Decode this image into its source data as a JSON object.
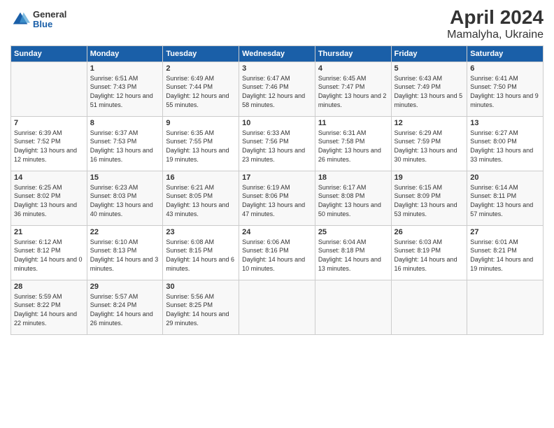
{
  "header": {
    "logo_general": "General",
    "logo_blue": "Blue",
    "title": "April 2024",
    "subtitle": "Mamalyha, Ukraine"
  },
  "columns": [
    "Sunday",
    "Monday",
    "Tuesday",
    "Wednesday",
    "Thursday",
    "Friday",
    "Saturday"
  ],
  "weeks": [
    [
      {
        "day": "",
        "sunrise": "",
        "sunset": "",
        "daylight": ""
      },
      {
        "day": "1",
        "sunrise": "Sunrise: 6:51 AM",
        "sunset": "Sunset: 7:43 PM",
        "daylight": "Daylight: 12 hours and 51 minutes."
      },
      {
        "day": "2",
        "sunrise": "Sunrise: 6:49 AM",
        "sunset": "Sunset: 7:44 PM",
        "daylight": "Daylight: 12 hours and 55 minutes."
      },
      {
        "day": "3",
        "sunrise": "Sunrise: 6:47 AM",
        "sunset": "Sunset: 7:46 PM",
        "daylight": "Daylight: 12 hours and 58 minutes."
      },
      {
        "day": "4",
        "sunrise": "Sunrise: 6:45 AM",
        "sunset": "Sunset: 7:47 PM",
        "daylight": "Daylight: 13 hours and 2 minutes."
      },
      {
        "day": "5",
        "sunrise": "Sunrise: 6:43 AM",
        "sunset": "Sunset: 7:49 PM",
        "daylight": "Daylight: 13 hours and 5 minutes."
      },
      {
        "day": "6",
        "sunrise": "Sunrise: 6:41 AM",
        "sunset": "Sunset: 7:50 PM",
        "daylight": "Daylight: 13 hours and 9 minutes."
      }
    ],
    [
      {
        "day": "7",
        "sunrise": "Sunrise: 6:39 AM",
        "sunset": "Sunset: 7:52 PM",
        "daylight": "Daylight: 13 hours and 12 minutes."
      },
      {
        "day": "8",
        "sunrise": "Sunrise: 6:37 AM",
        "sunset": "Sunset: 7:53 PM",
        "daylight": "Daylight: 13 hours and 16 minutes."
      },
      {
        "day": "9",
        "sunrise": "Sunrise: 6:35 AM",
        "sunset": "Sunset: 7:55 PM",
        "daylight": "Daylight: 13 hours and 19 minutes."
      },
      {
        "day": "10",
        "sunrise": "Sunrise: 6:33 AM",
        "sunset": "Sunset: 7:56 PM",
        "daylight": "Daylight: 13 hours and 23 minutes."
      },
      {
        "day": "11",
        "sunrise": "Sunrise: 6:31 AM",
        "sunset": "Sunset: 7:58 PM",
        "daylight": "Daylight: 13 hours and 26 minutes."
      },
      {
        "day": "12",
        "sunrise": "Sunrise: 6:29 AM",
        "sunset": "Sunset: 7:59 PM",
        "daylight": "Daylight: 13 hours and 30 minutes."
      },
      {
        "day": "13",
        "sunrise": "Sunrise: 6:27 AM",
        "sunset": "Sunset: 8:00 PM",
        "daylight": "Daylight: 13 hours and 33 minutes."
      }
    ],
    [
      {
        "day": "14",
        "sunrise": "Sunrise: 6:25 AM",
        "sunset": "Sunset: 8:02 PM",
        "daylight": "Daylight: 13 hours and 36 minutes."
      },
      {
        "day": "15",
        "sunrise": "Sunrise: 6:23 AM",
        "sunset": "Sunset: 8:03 PM",
        "daylight": "Daylight: 13 hours and 40 minutes."
      },
      {
        "day": "16",
        "sunrise": "Sunrise: 6:21 AM",
        "sunset": "Sunset: 8:05 PM",
        "daylight": "Daylight: 13 hours and 43 minutes."
      },
      {
        "day": "17",
        "sunrise": "Sunrise: 6:19 AM",
        "sunset": "Sunset: 8:06 PM",
        "daylight": "Daylight: 13 hours and 47 minutes."
      },
      {
        "day": "18",
        "sunrise": "Sunrise: 6:17 AM",
        "sunset": "Sunset: 8:08 PM",
        "daylight": "Daylight: 13 hours and 50 minutes."
      },
      {
        "day": "19",
        "sunrise": "Sunrise: 6:15 AM",
        "sunset": "Sunset: 8:09 PM",
        "daylight": "Daylight: 13 hours and 53 minutes."
      },
      {
        "day": "20",
        "sunrise": "Sunrise: 6:14 AM",
        "sunset": "Sunset: 8:11 PM",
        "daylight": "Daylight: 13 hours and 57 minutes."
      }
    ],
    [
      {
        "day": "21",
        "sunrise": "Sunrise: 6:12 AM",
        "sunset": "Sunset: 8:12 PM",
        "daylight": "Daylight: 14 hours and 0 minutes."
      },
      {
        "day": "22",
        "sunrise": "Sunrise: 6:10 AM",
        "sunset": "Sunset: 8:13 PM",
        "daylight": "Daylight: 14 hours and 3 minutes."
      },
      {
        "day": "23",
        "sunrise": "Sunrise: 6:08 AM",
        "sunset": "Sunset: 8:15 PM",
        "daylight": "Daylight: 14 hours and 6 minutes."
      },
      {
        "day": "24",
        "sunrise": "Sunrise: 6:06 AM",
        "sunset": "Sunset: 8:16 PM",
        "daylight": "Daylight: 14 hours and 10 minutes."
      },
      {
        "day": "25",
        "sunrise": "Sunrise: 6:04 AM",
        "sunset": "Sunset: 8:18 PM",
        "daylight": "Daylight: 14 hours and 13 minutes."
      },
      {
        "day": "26",
        "sunrise": "Sunrise: 6:03 AM",
        "sunset": "Sunset: 8:19 PM",
        "daylight": "Daylight: 14 hours and 16 minutes."
      },
      {
        "day": "27",
        "sunrise": "Sunrise: 6:01 AM",
        "sunset": "Sunset: 8:21 PM",
        "daylight": "Daylight: 14 hours and 19 minutes."
      }
    ],
    [
      {
        "day": "28",
        "sunrise": "Sunrise: 5:59 AM",
        "sunset": "Sunset: 8:22 PM",
        "daylight": "Daylight: 14 hours and 22 minutes."
      },
      {
        "day": "29",
        "sunrise": "Sunrise: 5:57 AM",
        "sunset": "Sunset: 8:24 PM",
        "daylight": "Daylight: 14 hours and 26 minutes."
      },
      {
        "day": "30",
        "sunrise": "Sunrise: 5:56 AM",
        "sunset": "Sunset: 8:25 PM",
        "daylight": "Daylight: 14 hours and 29 minutes."
      },
      {
        "day": "",
        "sunrise": "",
        "sunset": "",
        "daylight": ""
      },
      {
        "day": "",
        "sunrise": "",
        "sunset": "",
        "daylight": ""
      },
      {
        "day": "",
        "sunrise": "",
        "sunset": "",
        "daylight": ""
      },
      {
        "day": "",
        "sunrise": "",
        "sunset": "",
        "daylight": ""
      }
    ]
  ]
}
